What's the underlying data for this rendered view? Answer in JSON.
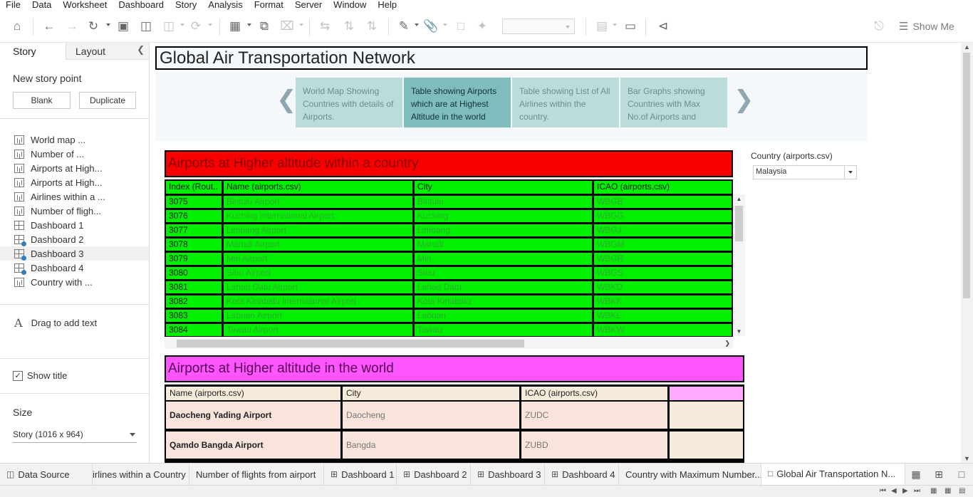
{
  "menu": [
    "File",
    "Data",
    "Worksheet",
    "Dashboard",
    "Story",
    "Analysis",
    "Format",
    "Server",
    "Window",
    "Help"
  ],
  "toolbar": {
    "show_me_label": "Show Me",
    "icons": [
      "home-icon",
      "undo-icon",
      "redo-icon",
      "replay-icon",
      "save-icon",
      "new-data-source-icon",
      "pause-updates-icon",
      "refresh-icon",
      "new-worksheet-icon",
      "duplicate-sheet-icon",
      "clear-sheet-icon",
      "swap-icon",
      "sort-ascending-icon",
      "sort-descending-icon",
      "highlight-icon",
      "group-icon",
      "label-icon",
      "pin-icon",
      "view-cards-icon",
      "presentation-icon",
      "share-icon",
      "format-painter-icon",
      "show-me-icon"
    ]
  },
  "left_panel": {
    "tab_story": "Story",
    "tab_layout": "Layout",
    "new_story_point_label": "New story point",
    "blank_button": "Blank",
    "duplicate_button": "Duplicate",
    "sheets": [
      {
        "label": "World map ...",
        "type": "worksheet"
      },
      {
        "label": "Number of ...",
        "type": "worksheet"
      },
      {
        "label": "Airports at High...",
        "type": "worksheet"
      },
      {
        "label": "Airports at High...",
        "type": "worksheet"
      },
      {
        "label": "Airlines within a ...",
        "type": "worksheet"
      },
      {
        "label": "Number of fligh...",
        "type": "worksheet"
      },
      {
        "label": "Dashboard 1",
        "type": "dashboard"
      },
      {
        "label": "Dashboard 2",
        "type": "dashboard"
      },
      {
        "label": "Dashboard 3",
        "type": "dashboard"
      },
      {
        "label": "Dashboard 4",
        "type": "dashboard"
      },
      {
        "label": "Country with ...",
        "type": "worksheet"
      }
    ],
    "drag_text_label": "Drag to add text",
    "show_title_label": "Show title",
    "show_title_checked": true,
    "size_label": "Size",
    "size_value": "Story (1016 x 964)"
  },
  "story": {
    "title": "Global Air Transportation Network",
    "points": [
      "World Map Showing Countries with details of  Airports.",
      "Table showing Airports which are at Highest Altitude in the world",
      "Table showing List of All Airlines within the country.",
      "Bar Graphs showing Countries  with Max No.of Airports and"
    ],
    "active_point": 1
  },
  "dashboard": {
    "table1": {
      "title": "Airports at Higher altitude within a country",
      "headers": [
        "Index (Rout..",
        "Name (airports.csv)",
        "City",
        "ICAO (airports.csv)"
      ],
      "rows": [
        [
          "3075",
          "Bintulu Airport",
          "Bintulu",
          "WBGB"
        ],
        [
          "3076",
          "Kuching International Airport",
          "Kuching",
          "WBGG"
        ],
        [
          "3077",
          "Limbang Airport",
          "Limbang",
          "WBGJ"
        ],
        [
          "3078",
          "Marudi Airport",
          "Marudi",
          "WBGM"
        ],
        [
          "3079",
          "Miri Airport",
          "Miri",
          "WBGR"
        ],
        [
          "3080",
          "Sibu Airport",
          "Sibu",
          "WBGS"
        ],
        [
          "3081",
          "Lahad Datu Airport",
          "Lahad Datu",
          "WBKD"
        ],
        [
          "3082",
          "Kota Kinabalu International Airport",
          "Kota Kinabalu",
          "WBKK"
        ],
        [
          "3083",
          "Labuan Airport",
          "Labuan",
          "WBKL"
        ],
        [
          "3084",
          "Tawau Airport",
          "Tawau",
          "WBKW"
        ]
      ],
      "colors": {
        "header_bg": "#f80000",
        "cell_bg": "#00f000"
      }
    },
    "filter": {
      "label": "Country (airports.csv)",
      "value": "Malaysia"
    },
    "table2": {
      "title": "Airports at Higher altitude in the world",
      "headers": [
        "Name (airports.csv)",
        "City",
        "ICAO (airports.csv)",
        ""
      ],
      "rows": [
        [
          "Daocheng Yading Airport",
          "Daocheng",
          "ZUDC",
          ""
        ],
        [
          "Qamdo Bangda Airport",
          "Bangda",
          "ZUBD",
          ""
        ]
      ],
      "colors": {
        "header_bg": "#ff55ff"
      }
    }
  },
  "sheet_tabs": [
    {
      "label": "Data Source",
      "icon": "database-icon"
    },
    {
      "label": "irlines within a Country",
      "icon": ""
    },
    {
      "label": "Number of flights from airport",
      "icon": ""
    },
    {
      "label": "Dashboard 1",
      "icon": "dashboard-icon"
    },
    {
      "label": "Dashboard 2",
      "icon": "dashboard-icon"
    },
    {
      "label": "Dashboard 3",
      "icon": "dashboard-icon"
    },
    {
      "label": "Dashboard 4",
      "icon": "dashboard-icon"
    },
    {
      "label": "Country with Maximum Number...",
      "icon": ""
    },
    {
      "label": "Global Air Transportation N...",
      "icon": "story-icon"
    }
  ]
}
